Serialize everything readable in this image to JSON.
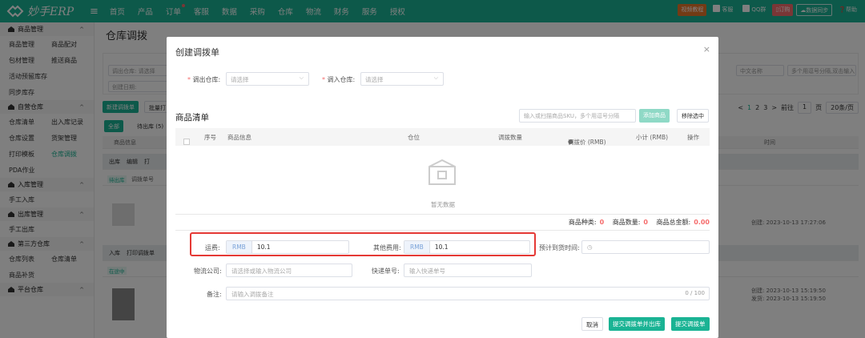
{
  "app": {
    "logo_text": "妙手ERP"
  },
  "topnav": {
    "items": [
      "首页",
      "产品",
      "订单",
      "客服",
      "数据",
      "采购",
      "仓库",
      "物流",
      "财务",
      "服务",
      "授权"
    ],
    "right": {
      "video": "视频教程",
      "service": "客服",
      "qq": "QQ群",
      "order": "订购",
      "sync": "数据同步",
      "help": "帮助"
    }
  },
  "sidebar": {
    "sections": [
      {
        "title": "商品管理",
        "rows": [
          [
            "商品管理",
            "商品配对"
          ],
          [
            "包材管理",
            "推送商品"
          ],
          [
            "活动预留库存",
            ""
          ],
          [
            "同步库存",
            ""
          ]
        ]
      },
      {
        "title": "自营仓库",
        "rows": [
          [
            "仓库清单",
            "出入库记录"
          ],
          [
            "仓库设置",
            "货架管理"
          ],
          [
            "打印模板",
            "仓库调拨"
          ],
          [
            "PDA作业",
            ""
          ]
        ]
      },
      {
        "title": "入库管理",
        "rows": [
          [
            "手工入库",
            ""
          ]
        ]
      },
      {
        "title": "出库管理",
        "rows": [
          [
            "手工出库",
            ""
          ]
        ]
      },
      {
        "title": "第三方仓库",
        "rows": [
          [
            "仓库列表",
            "仓库清单"
          ],
          [
            "商品补货",
            ""
          ]
        ]
      },
      {
        "title": "平台仓库",
        "rows": []
      }
    ]
  },
  "page": {
    "title": "仓库调拨",
    "bg": {
      "out_wh": "调出仓库:",
      "placeholder": "请选择",
      "created_date": "创建日期:",
      "name_select": "中文名称",
      "multi_search": "多个用逗号分隔,双击输入",
      "new_btn": "新建调拨单",
      "batch_btn": "批量打",
      "tab_all": "全部",
      "tab_pending": "待出库 (5)",
      "col_goods": "商品信息",
      "col_time": "时间",
      "row_out": "出库",
      "row_edit": "编辑",
      "row_print": "打",
      "badge_pending": "待出库",
      "order_no": "调拨单号",
      "row_in": "入库",
      "row_print_order": "打印调拨单",
      "badge_transit": "在途中",
      "ts1": "创建: 2023-10-13 17:27:06",
      "ts2a": "创建: 2023-10-13 15:19:50",
      "ts2b": "发货: 2023-10-13 15:19:50"
    },
    "pager": {
      "prev": "<",
      "p1": "1",
      "p2": "2",
      "p3": "3",
      "next": ">",
      "goto": "前往",
      "page_no": "1",
      "page_unit": "页",
      "size": "20条/页"
    }
  },
  "modal": {
    "title": "创建调拨单",
    "close": "×",
    "out_wh_label": "调出仓库:",
    "in_wh_label": "调入仓库:",
    "select_placeholder": "请选择",
    "section_title": "商品清单",
    "scan_placeholder": "输入或扫描商品SKU，多个用逗号分隔",
    "add_btn": "添加商品",
    "remove_btn": "移除选中",
    "columns": {
      "seq": "序号",
      "info": "商品信息",
      "location": "仓位",
      "qty": "调拨数量",
      "price": "调拨价 (RMB)",
      "subtotal": "小计 (RMB)",
      "action": "操作"
    },
    "empty_text": "暂无数据",
    "stats": {
      "kinds_label": "商品种类:",
      "kinds": "0",
      "qty_label": "商品数量:",
      "qty": "0",
      "total_label": "商品总金额:",
      "total": "0.00"
    },
    "freight_label": "运费:",
    "currency": "RMB",
    "freight": "10.1",
    "other_label": "其他费用:",
    "other": "10.1",
    "eta_label": "预计到货时间:",
    "logistics_label": "物流公司:",
    "logistics_placeholder": "请选择或输入物流公司",
    "tracking_label": "快递单号:",
    "tracking_placeholder": "输入快递单号",
    "remark_label": "备注:",
    "remark_placeholder": "请输入调拨备注",
    "remark_count": "0 / 100",
    "cancel": "取消",
    "submit_out": "提交调拨单并出库",
    "submit": "提交调拨单"
  }
}
